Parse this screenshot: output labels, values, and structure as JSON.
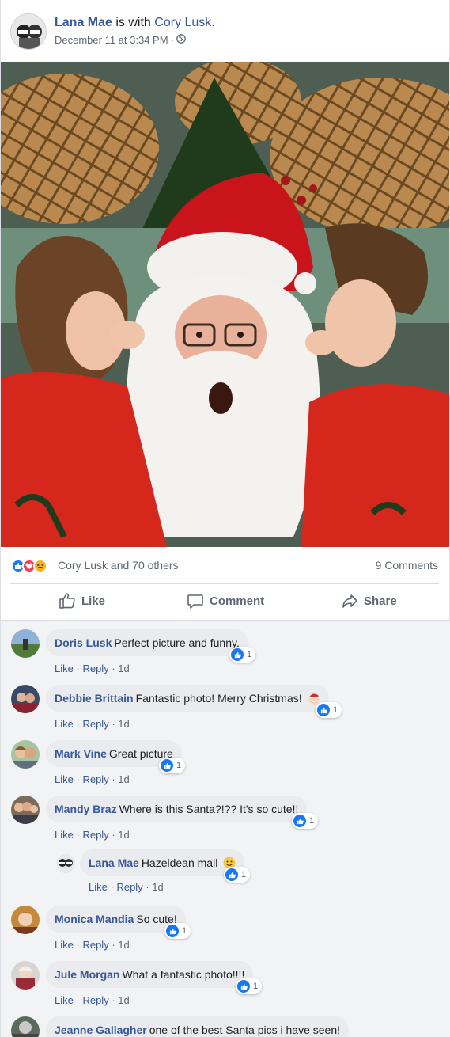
{
  "post": {
    "author": "Lana Mae",
    "with_text": "is with",
    "tagged": "Cory Lusk.",
    "date": "December 11 at 3:34 PM",
    "separator": "·",
    "privacy_icon": "globe-icon"
  },
  "photo": {
    "icon": "santa-photo"
  },
  "reactions": {
    "summary": "Cory Lusk and 70 others",
    "comments": "9 Comments",
    "icons": [
      "like-reaction-icon",
      "love-reaction-icon",
      "haha-reaction-icon"
    ],
    "colors": {
      "like": "#1877f2",
      "love": "#f33e58",
      "haha": "#f7b125"
    }
  },
  "actions": {
    "like": "Like",
    "comment": "Comment",
    "share": "Share"
  },
  "comment_actions": {
    "like": "Like",
    "reply": "Reply",
    "sep": "·"
  },
  "comments": [
    {
      "author": "Doris Lusk",
      "text": "Perfect picture and funny.",
      "time": "1d",
      "likes": "1"
    },
    {
      "author": "Debbie Brittain",
      "text": "Fantastic photo! Merry Christmas!",
      "time": "1d",
      "likes": "1",
      "emoji": "santa-emoji"
    },
    {
      "author": "Mark Vine",
      "text": "Great picture",
      "time": "1d",
      "likes": "1"
    },
    {
      "author": "Mandy Braz",
      "text": "Where is this Santa?!?? It's so cute!!",
      "time": "1d",
      "likes": "1"
    },
    {
      "author": "Lana Mae",
      "text": "Hazeldean mall",
      "time": "1d",
      "likes": "1",
      "emoji": "smile-emoji",
      "is_reply": true
    },
    {
      "author": "Monica Mandia",
      "text": "So cute!",
      "time": "1d",
      "likes": "1"
    },
    {
      "author": "Jule Morgan",
      "text": "What a fantastic photo!!!!",
      "time": "1d",
      "likes": "1"
    },
    {
      "author": "Jeanne Gallagher",
      "text": "one of the best Santa pics i have seen!"
    }
  ]
}
